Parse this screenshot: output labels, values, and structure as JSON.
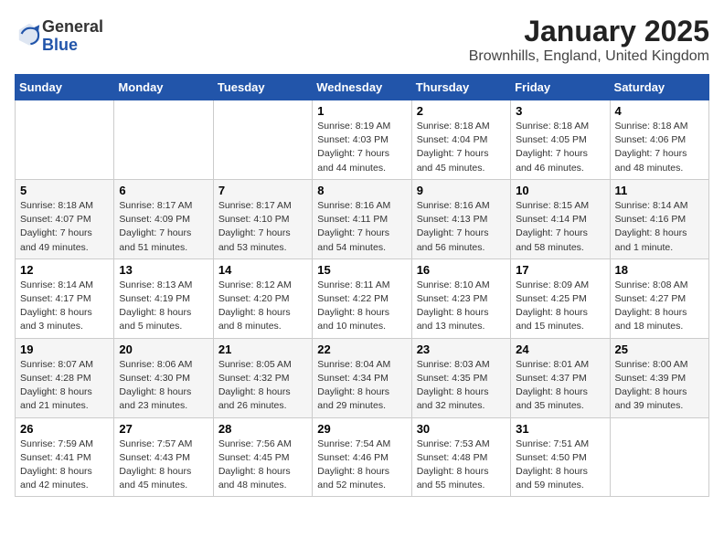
{
  "header": {
    "logo_line1": "General",
    "logo_line2": "Blue",
    "title": "January 2025",
    "subtitle": "Brownhills, England, United Kingdom"
  },
  "days_of_week": [
    "Sunday",
    "Monday",
    "Tuesday",
    "Wednesday",
    "Thursday",
    "Friday",
    "Saturday"
  ],
  "weeks": [
    [
      {
        "num": "",
        "info": ""
      },
      {
        "num": "",
        "info": ""
      },
      {
        "num": "",
        "info": ""
      },
      {
        "num": "1",
        "info": "Sunrise: 8:19 AM\nSunset: 4:03 PM\nDaylight: 7 hours and 44 minutes."
      },
      {
        "num": "2",
        "info": "Sunrise: 8:18 AM\nSunset: 4:04 PM\nDaylight: 7 hours and 45 minutes."
      },
      {
        "num": "3",
        "info": "Sunrise: 8:18 AM\nSunset: 4:05 PM\nDaylight: 7 hours and 46 minutes."
      },
      {
        "num": "4",
        "info": "Sunrise: 8:18 AM\nSunset: 4:06 PM\nDaylight: 7 hours and 48 minutes."
      }
    ],
    [
      {
        "num": "5",
        "info": "Sunrise: 8:18 AM\nSunset: 4:07 PM\nDaylight: 7 hours and 49 minutes."
      },
      {
        "num": "6",
        "info": "Sunrise: 8:17 AM\nSunset: 4:09 PM\nDaylight: 7 hours and 51 minutes."
      },
      {
        "num": "7",
        "info": "Sunrise: 8:17 AM\nSunset: 4:10 PM\nDaylight: 7 hours and 53 minutes."
      },
      {
        "num": "8",
        "info": "Sunrise: 8:16 AM\nSunset: 4:11 PM\nDaylight: 7 hours and 54 minutes."
      },
      {
        "num": "9",
        "info": "Sunrise: 8:16 AM\nSunset: 4:13 PM\nDaylight: 7 hours and 56 minutes."
      },
      {
        "num": "10",
        "info": "Sunrise: 8:15 AM\nSunset: 4:14 PM\nDaylight: 7 hours and 58 minutes."
      },
      {
        "num": "11",
        "info": "Sunrise: 8:14 AM\nSunset: 4:16 PM\nDaylight: 8 hours and 1 minute."
      }
    ],
    [
      {
        "num": "12",
        "info": "Sunrise: 8:14 AM\nSunset: 4:17 PM\nDaylight: 8 hours and 3 minutes."
      },
      {
        "num": "13",
        "info": "Sunrise: 8:13 AM\nSunset: 4:19 PM\nDaylight: 8 hours and 5 minutes."
      },
      {
        "num": "14",
        "info": "Sunrise: 8:12 AM\nSunset: 4:20 PM\nDaylight: 8 hours and 8 minutes."
      },
      {
        "num": "15",
        "info": "Sunrise: 8:11 AM\nSunset: 4:22 PM\nDaylight: 8 hours and 10 minutes."
      },
      {
        "num": "16",
        "info": "Sunrise: 8:10 AM\nSunset: 4:23 PM\nDaylight: 8 hours and 13 minutes."
      },
      {
        "num": "17",
        "info": "Sunrise: 8:09 AM\nSunset: 4:25 PM\nDaylight: 8 hours and 15 minutes."
      },
      {
        "num": "18",
        "info": "Sunrise: 8:08 AM\nSunset: 4:27 PM\nDaylight: 8 hours and 18 minutes."
      }
    ],
    [
      {
        "num": "19",
        "info": "Sunrise: 8:07 AM\nSunset: 4:28 PM\nDaylight: 8 hours and 21 minutes."
      },
      {
        "num": "20",
        "info": "Sunrise: 8:06 AM\nSunset: 4:30 PM\nDaylight: 8 hours and 23 minutes."
      },
      {
        "num": "21",
        "info": "Sunrise: 8:05 AM\nSunset: 4:32 PM\nDaylight: 8 hours and 26 minutes."
      },
      {
        "num": "22",
        "info": "Sunrise: 8:04 AM\nSunset: 4:34 PM\nDaylight: 8 hours and 29 minutes."
      },
      {
        "num": "23",
        "info": "Sunrise: 8:03 AM\nSunset: 4:35 PM\nDaylight: 8 hours and 32 minutes."
      },
      {
        "num": "24",
        "info": "Sunrise: 8:01 AM\nSunset: 4:37 PM\nDaylight: 8 hours and 35 minutes."
      },
      {
        "num": "25",
        "info": "Sunrise: 8:00 AM\nSunset: 4:39 PM\nDaylight: 8 hours and 39 minutes."
      }
    ],
    [
      {
        "num": "26",
        "info": "Sunrise: 7:59 AM\nSunset: 4:41 PM\nDaylight: 8 hours and 42 minutes."
      },
      {
        "num": "27",
        "info": "Sunrise: 7:57 AM\nSunset: 4:43 PM\nDaylight: 8 hours and 45 minutes."
      },
      {
        "num": "28",
        "info": "Sunrise: 7:56 AM\nSunset: 4:45 PM\nDaylight: 8 hours and 48 minutes."
      },
      {
        "num": "29",
        "info": "Sunrise: 7:54 AM\nSunset: 4:46 PM\nDaylight: 8 hours and 52 minutes."
      },
      {
        "num": "30",
        "info": "Sunrise: 7:53 AM\nSunset: 4:48 PM\nDaylight: 8 hours and 55 minutes."
      },
      {
        "num": "31",
        "info": "Sunrise: 7:51 AM\nSunset: 4:50 PM\nDaylight: 8 hours and 59 minutes."
      },
      {
        "num": "",
        "info": ""
      }
    ]
  ]
}
